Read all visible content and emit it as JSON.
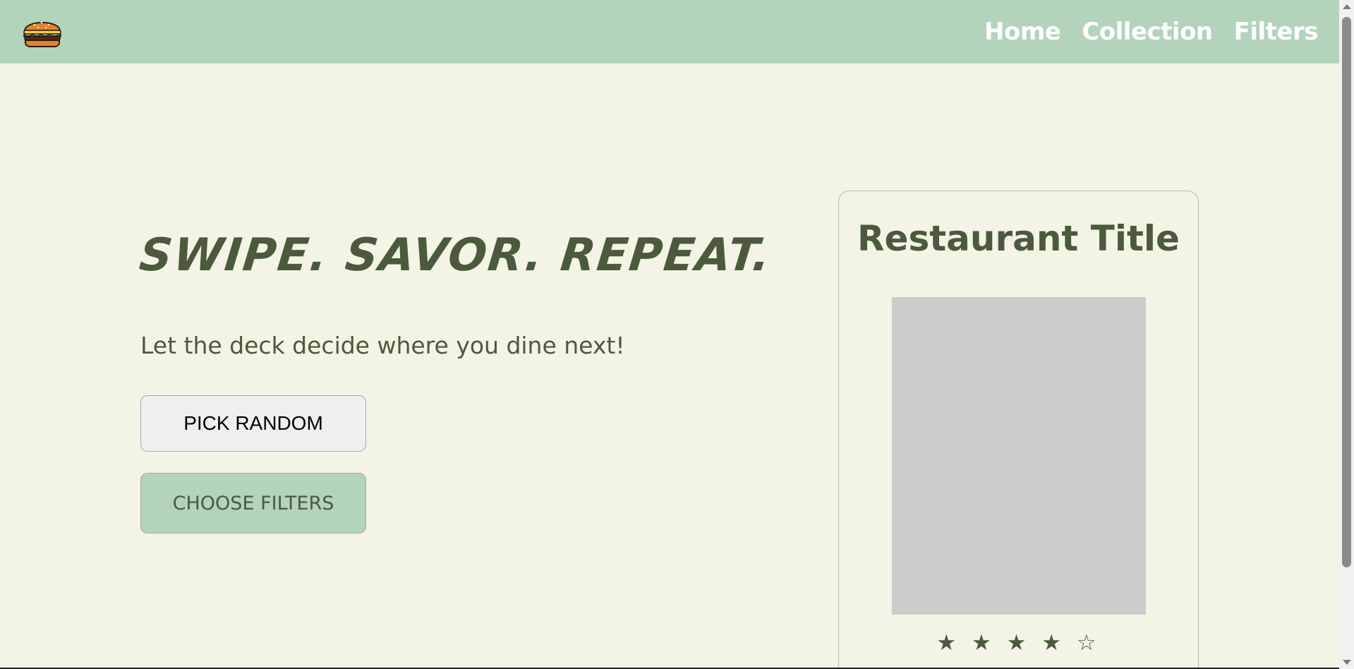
{
  "header": {
    "logo_icon": "burger-icon",
    "nav": [
      {
        "label": "Home"
      },
      {
        "label": "Collection"
      },
      {
        "label": "Filters"
      }
    ]
  },
  "hero": {
    "title": "SWIPE. SAVOR. REPEAT.",
    "subtitle": "Let the deck decide where you dine next!",
    "pick_random_label": "PICK RANDOM",
    "choose_filters_label": "CHOOSE FILTERS"
  },
  "card": {
    "title": "Restaurant Title",
    "rating_stars": "★ ★ ★ ★ ☆",
    "rating": 4,
    "rating_max": 5
  },
  "colors": {
    "background": "#f3f4e5",
    "navbar": "#b3d3bb",
    "accent_text": "#4b5a3c",
    "image_placeholder": "#cccccc"
  }
}
